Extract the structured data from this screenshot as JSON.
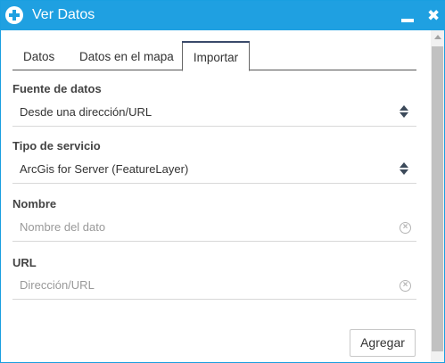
{
  "window": {
    "title": "Ver Datos",
    "title_icon": "add-circle-icon",
    "minimize_icon": "minimize-icon",
    "close_icon": "close-icon",
    "close_glyph": "✖",
    "accent_color": "#1fa0e1"
  },
  "tabs": [
    {
      "label": "Datos",
      "active": false
    },
    {
      "label": "Datos en el mapa",
      "active": false
    },
    {
      "label": "Importar",
      "active": true
    }
  ],
  "form": {
    "source": {
      "label": "Fuente de datos",
      "value": "Desde una dirección/URL"
    },
    "service_type": {
      "label": "Tipo de servicio",
      "value": "ArcGis for Server (FeatureLayer)"
    },
    "name": {
      "label": "Nombre",
      "placeholder": "Nombre del dato",
      "value": ""
    },
    "url": {
      "label": "URL",
      "placeholder": "Dirección/URL",
      "value": ""
    },
    "clear_glyph": "×"
  },
  "actions": {
    "add_label": "Agregar"
  }
}
